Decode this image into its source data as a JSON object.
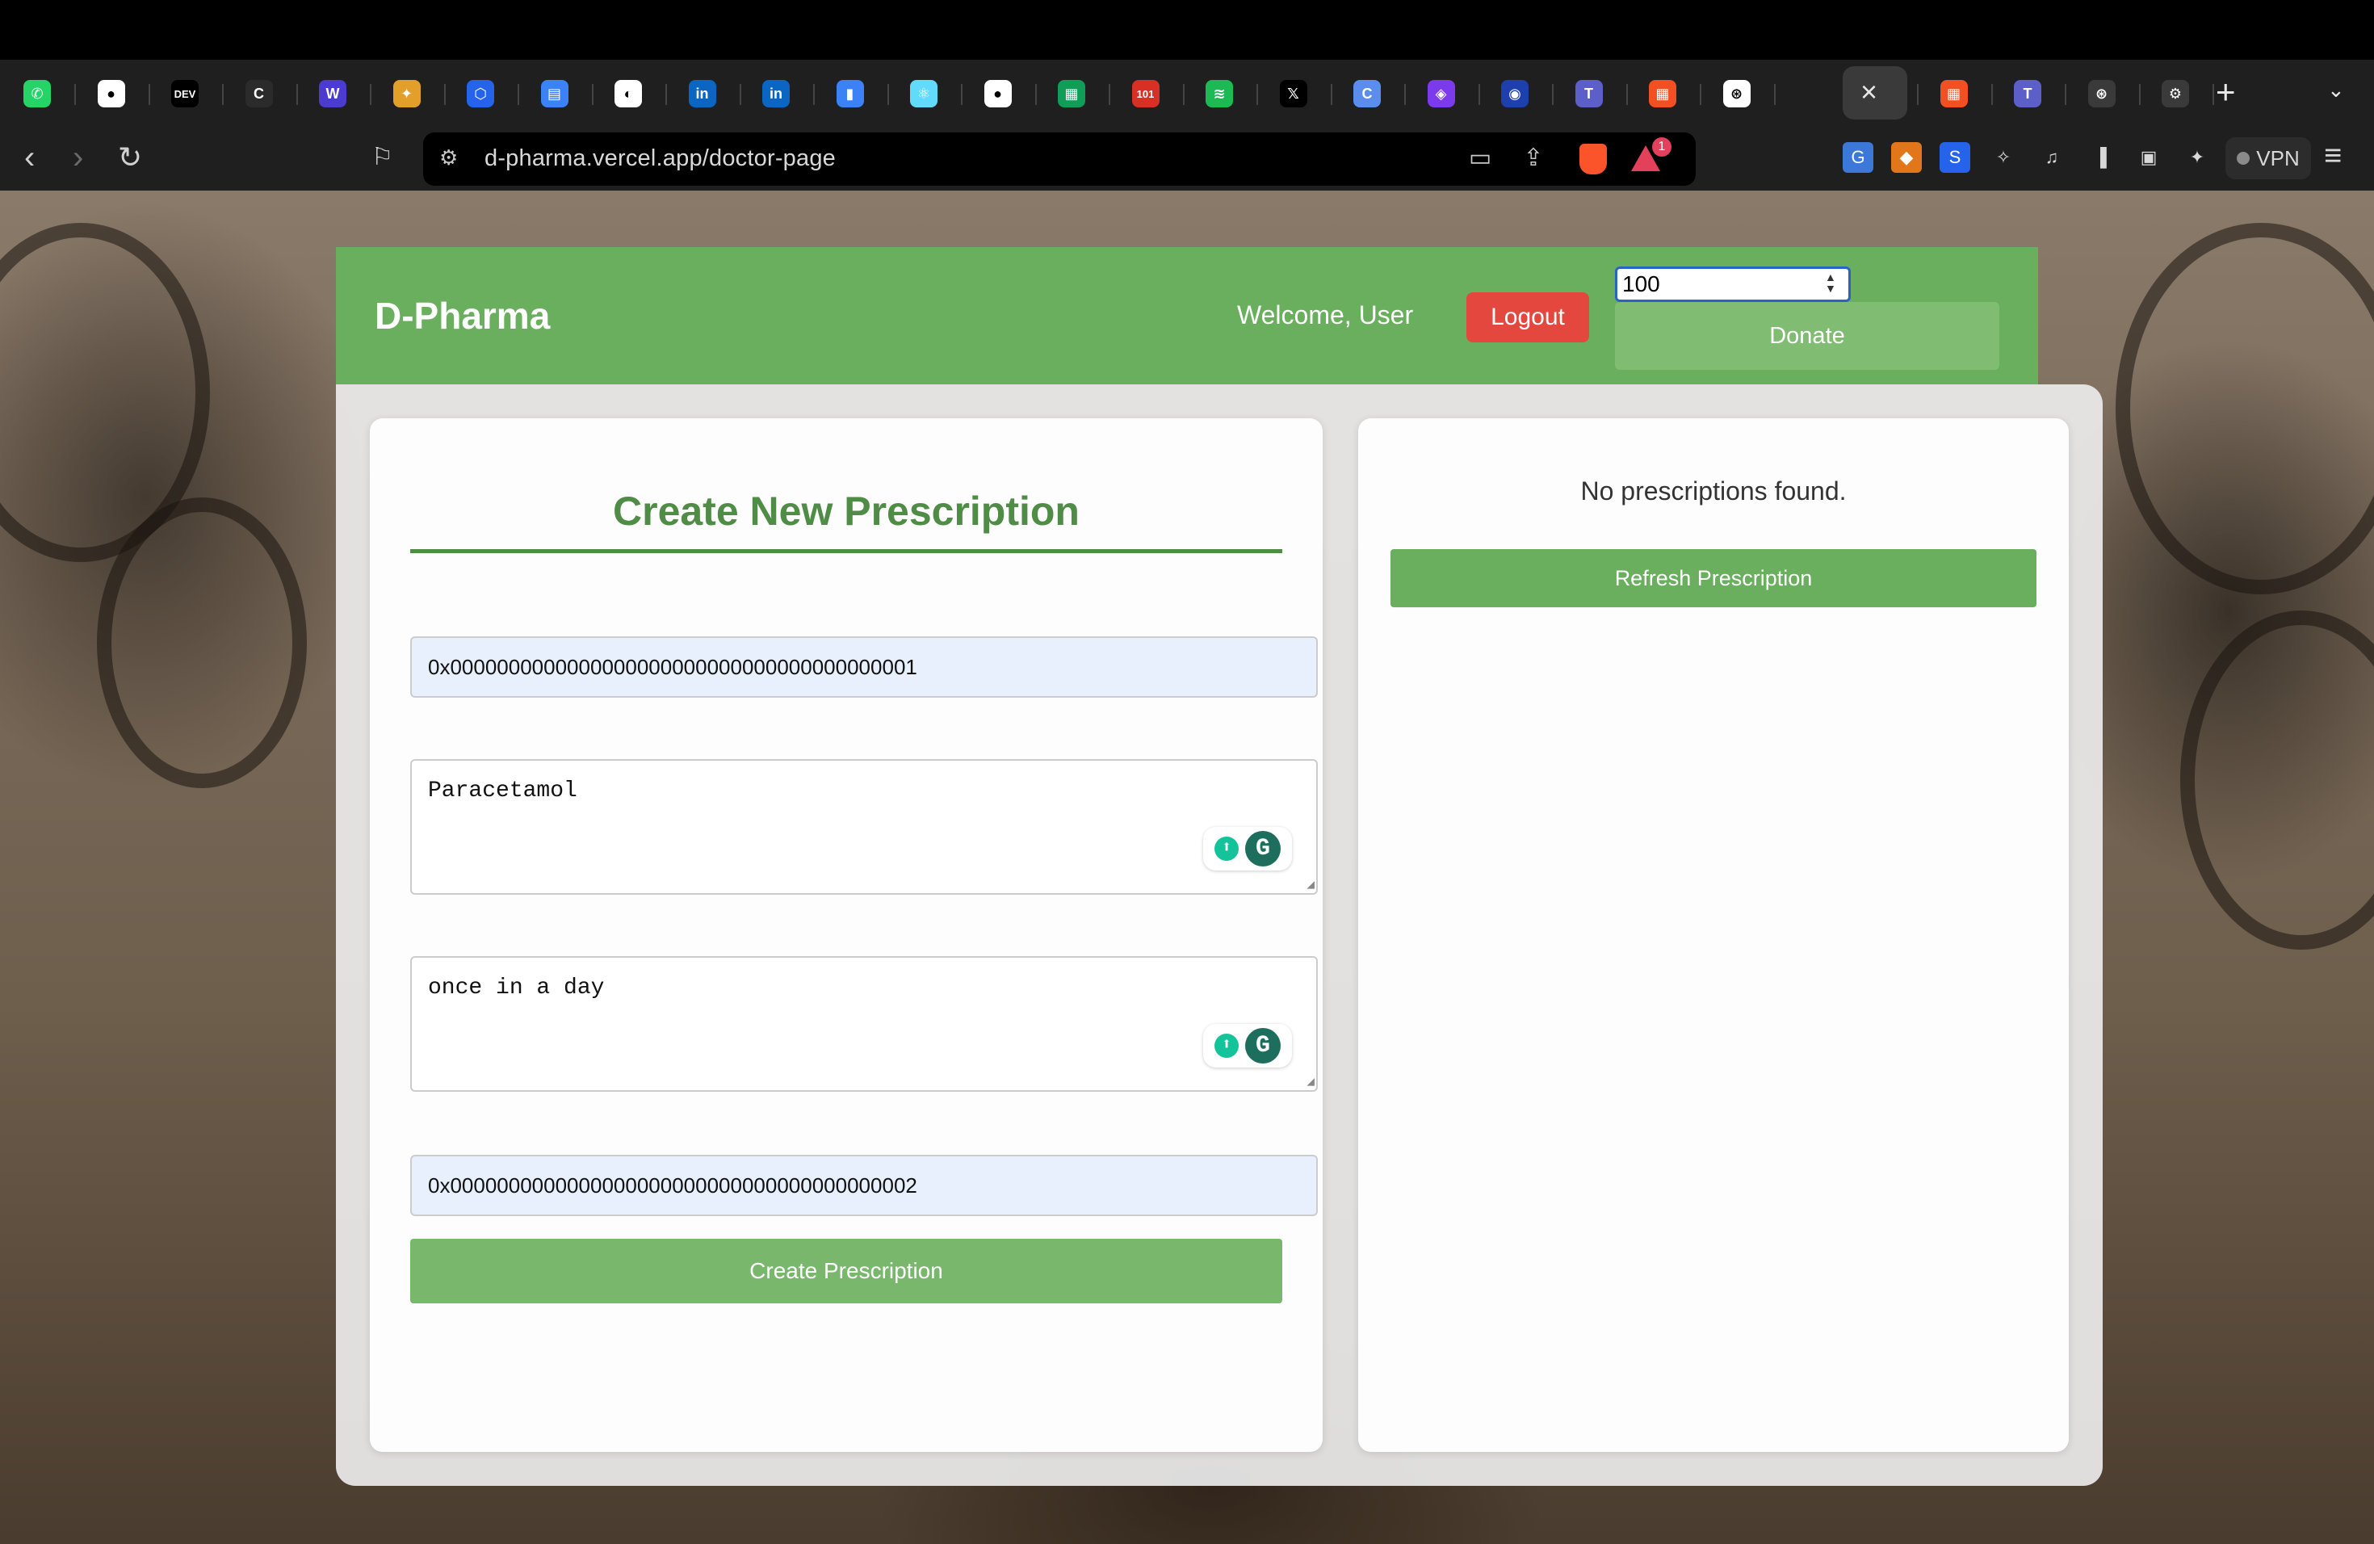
{
  "browser": {
    "tabs": [
      {
        "icon": "whatsapp-icon",
        "glyph": "✆",
        "color": "#25d366"
      },
      {
        "icon": "github-icon",
        "glyph": "●",
        "color": "#ffffff"
      },
      {
        "icon": "dev-icon",
        "glyph": "DEV",
        "color": "#000000"
      },
      {
        "icon": "coursera-icon",
        "glyph": "C",
        "color": "#2b2b2b"
      },
      {
        "icon": "webflow-icon",
        "glyph": "W",
        "color": "#4b3bcf"
      },
      {
        "icon": "colorful-icon",
        "glyph": "✦",
        "color": "#e2a02a"
      },
      {
        "icon": "hexagon-icon",
        "glyph": "⬡",
        "color": "#2563eb"
      },
      {
        "icon": "docs-icon",
        "glyph": "▤",
        "color": "#3b82f6"
      },
      {
        "icon": "analytics-icon",
        "glyph": "◐",
        "color": "#ffffff"
      },
      {
        "icon": "linkedin-icon",
        "glyph": "in",
        "color": "#0a66c2"
      },
      {
        "icon": "linkedin-icon",
        "glyph": "in",
        "color": "#0a66c2"
      },
      {
        "icon": "chart-icon",
        "glyph": "▮",
        "color": "#3b82f6"
      },
      {
        "icon": "react-icon",
        "glyph": "⚛",
        "color": "#61dafb"
      },
      {
        "icon": "github-icon",
        "glyph": "●",
        "color": "#ffffff"
      },
      {
        "icon": "sheets-icon",
        "glyph": "▦",
        "color": "#0f9d58"
      },
      {
        "icon": "badge-101-icon",
        "glyph": "101",
        "color": "#d93025"
      },
      {
        "icon": "spotify-icon",
        "glyph": "≋",
        "color": "#1db954"
      },
      {
        "icon": "x-icon",
        "glyph": "𝕏",
        "color": "#000000"
      },
      {
        "icon": "c-icon",
        "glyph": "C",
        "color": "#5b8def"
      },
      {
        "icon": "shield-icon",
        "glyph": "◈",
        "color": "#7c3aed"
      },
      {
        "icon": "copilot-icon",
        "glyph": "◉",
        "color": "#1e40af"
      },
      {
        "icon": "teams-icon",
        "glyph": "T",
        "color": "#5b5fc7"
      },
      {
        "icon": "microsoft-icon",
        "glyph": "▦",
        "color": "#f25022"
      },
      {
        "icon": "openai-icon",
        "glyph": "⊛",
        "color": "#ffffff"
      },
      {
        "icon": "openai-icon",
        "glyph": "⊛",
        "color": "#ffffff"
      },
      {
        "icon": "microsoft-icon",
        "glyph": "▦",
        "color": "#f25022"
      },
      {
        "icon": "teams-icon",
        "glyph": "T",
        "color": "#5b5fc7"
      },
      {
        "icon": "chatgpt-icon",
        "glyph": "⊛",
        "color": "#3a3a3a"
      },
      {
        "icon": "gear-icon",
        "glyph": "⚙",
        "color": "#3a3a3a"
      }
    ],
    "url": "d-pharma.vercel.app/doctor-page",
    "rewards_count": "1",
    "vpn_label": "VPN"
  },
  "header": {
    "brand": "D-Pharma",
    "welcome": "Welcome, User",
    "logout_label": "Logout",
    "donate_amount": "100",
    "donate_label": "Donate"
  },
  "form": {
    "title": "Create New Prescription",
    "patient_address": "0x0000000000000000000000000000000000000001",
    "medication": "Paracetamol",
    "dosage": "once in a day",
    "pharmacy_address": "0x0000000000000000000000000000000000000002",
    "submit_label": "Create Prescription"
  },
  "prescriptions": {
    "empty_message": "No prescriptions found.",
    "refresh_label": "Refresh Prescription"
  },
  "colors": {
    "header_green": "#6aaf5e",
    "title_green": "#4f8c45",
    "logout_red": "#e4473d"
  }
}
